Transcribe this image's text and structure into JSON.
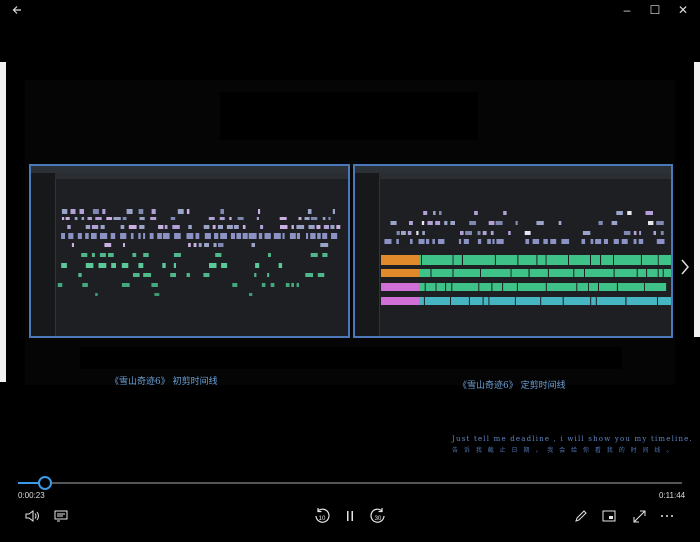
{
  "window": {
    "back_icon": "back-arrow-icon",
    "minimize_glyph": "–",
    "maximize_glyph": "☐",
    "close_glyph": "✕"
  },
  "video": {
    "caption_left": "《雪山奇迹6》 初剪时间线",
    "caption_right": "《雪山奇迹6》 定剪时间线",
    "quote_en": "Just tell me deadline , i will show you my timeline.",
    "quote_cn": "告 诉 我 截 止 日 期 ， 我 会 给 你 看 我 的 时 间 线 。"
  },
  "player": {
    "current_time": "0:00:23",
    "total_time": "0:11:44",
    "progress_fraction": 0.033,
    "skip_back_seconds": "10",
    "skip_forward_seconds": "30",
    "accent_color": "#3a9ae8"
  }
}
